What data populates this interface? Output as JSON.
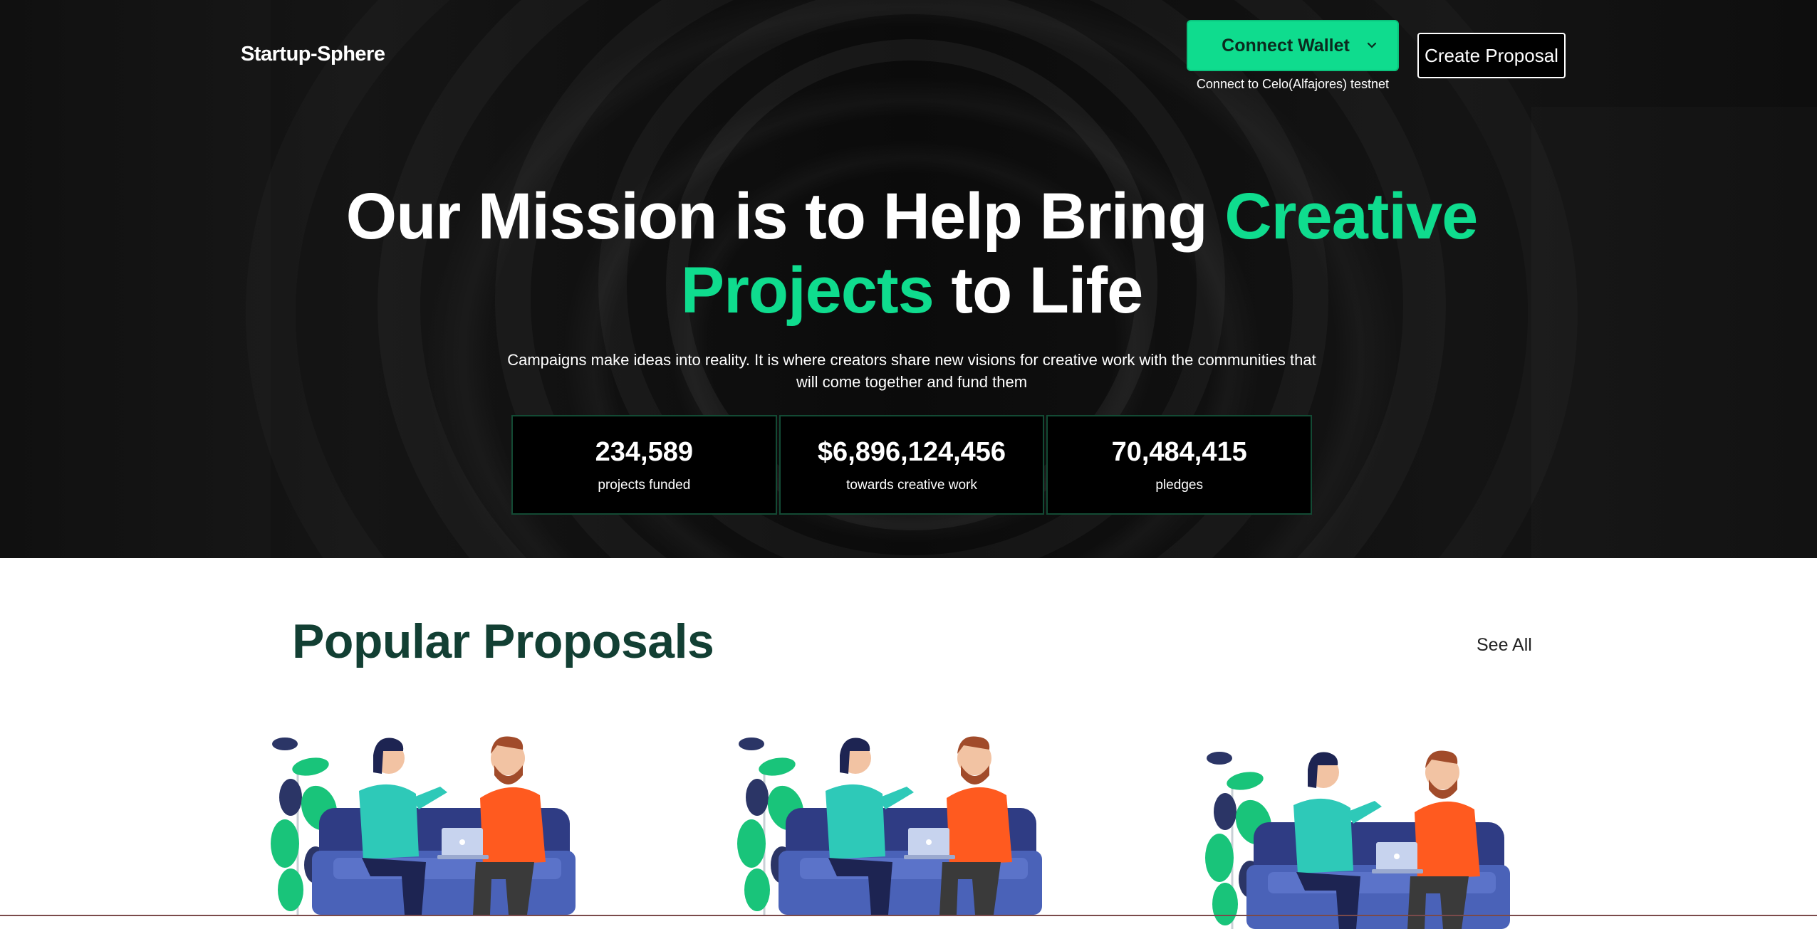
{
  "header": {
    "brand": "Startup-Sphere",
    "connect_wallet_label": "Connect Wallet",
    "connect_wallet_sub": "Connect to Celo(Alfajores) testnet",
    "create_proposal_label": "Create Proposal"
  },
  "hero": {
    "headline_part1": "Our Mission is to Help Bring ",
    "headline_accent1": "Creative",
    "headline_accent2": "Projects",
    "headline_part2": " to Life",
    "subtext": "Campaigns make ideas into reality. It is where creators share new visions for creative work with the communities that will come together and fund them"
  },
  "stats": [
    {
      "value": "234,589",
      "label": "projects funded"
    },
    {
      "value": "$6,896,124,456",
      "label": "towards creative work"
    },
    {
      "value": "70,484,415",
      "label": "pledges"
    }
  ],
  "proposals": {
    "title": "Popular Proposals",
    "see_all": "See All"
  },
  "colors": {
    "accent": "#0fdc8e",
    "section_title": "#123f33",
    "stat_border": "#134a34"
  }
}
